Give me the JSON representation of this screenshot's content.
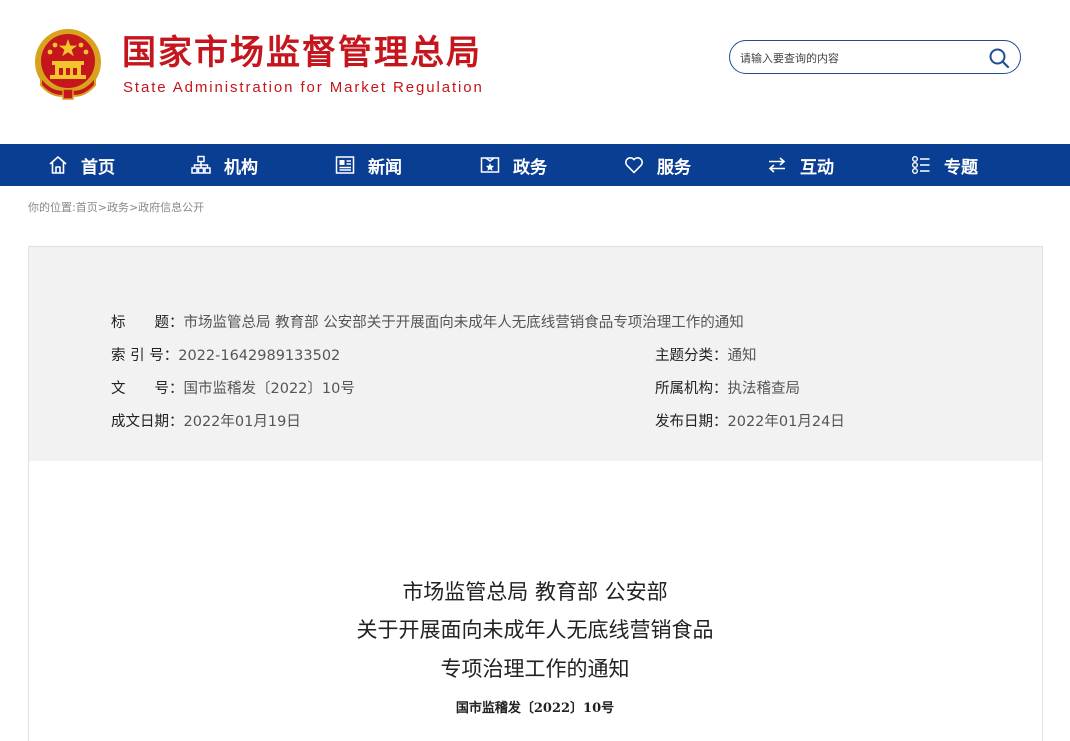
{
  "header": {
    "brand_cn": "国家市场监督管理总局",
    "brand_en": "State Administration for Market Regulation",
    "emblem_icon": "national-emblem-icon",
    "search": {
      "placeholder": "请输入要查询的内容",
      "value": "",
      "icon": "search-icon"
    }
  },
  "colors": {
    "brand_red": "#c4161c",
    "nav_blue": "#0a3e92",
    "meta_bg": "#f2f2f2"
  },
  "nav": {
    "items": [
      {
        "label": "首页",
        "icon": "home-icon"
      },
      {
        "label": "机构",
        "icon": "org-chart-icon"
      },
      {
        "label": "新闻",
        "icon": "news-icon"
      },
      {
        "label": "政务",
        "icon": "government-icon"
      },
      {
        "label": "服务",
        "icon": "heart-icon"
      },
      {
        "label": "互动",
        "icon": "exchange-icon"
      },
      {
        "label": "专题",
        "icon": "topic-list-icon"
      }
    ]
  },
  "breadcrumb": {
    "prefix": "你的位置:",
    "items": [
      "首页",
      "政务",
      "政府信息公开"
    ],
    "separator": ">"
  },
  "meta": {
    "title_key": "标　　题：",
    "title_value": "市场监管总局 教育部 公安部关于开展面向未成年人无底线营销食品专项治理工作的通知",
    "index_key": "索 引 号：",
    "index_value": "2022-1642989133502",
    "topic_key": "主题分类：",
    "topic_value": "通知",
    "docno_key": "文　　号：",
    "docno_value": "国市监稽发〔2022〕10号",
    "dept_key": "所属机构：",
    "dept_value": "执法稽查局",
    "created_key": "成文日期：",
    "created_value": "2022年01月19日",
    "published_key": "发布日期：",
    "published_value": "2022年01月24日"
  },
  "document": {
    "title_line1": "市场监管总局  教育部  公安部",
    "title_line2": "关于开展面向未成年人无底线营销食品",
    "title_line3": "专项治理工作的通知",
    "doc_number": "国市监稽发〔2022〕10号"
  }
}
